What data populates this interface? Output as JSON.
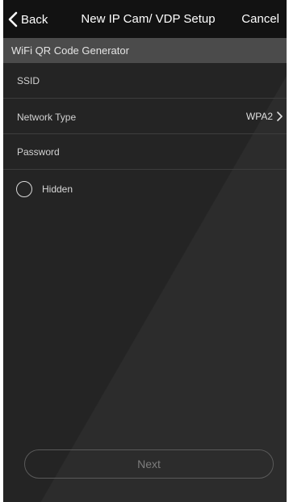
{
  "navbar": {
    "back_label": "Back",
    "title": "New IP Cam/ VDP Setup",
    "cancel_label": "Cancel"
  },
  "section": {
    "title": "WiFi QR Code Generator"
  },
  "form": {
    "ssid": {
      "placeholder": "SSID",
      "value": ""
    },
    "network_type": {
      "label": "Network Type",
      "value": "WPA2"
    },
    "password": {
      "placeholder": "Password",
      "value": ""
    },
    "hidden": {
      "label": "Hidden",
      "checked": false
    }
  },
  "actions": {
    "next_label": "Next"
  },
  "icons": {
    "back": "chevron-left-icon",
    "network_type": "chevron-right-icon"
  },
  "colors": {
    "navbar_bg": "#121212",
    "section_header_bg": "#4b4b4b",
    "background": "#242424",
    "text": "#d2d2d2",
    "next_text": "#7d7d7d"
  }
}
